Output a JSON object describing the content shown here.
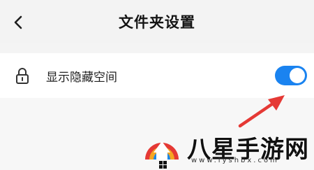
{
  "header": {
    "back_icon": "chevron-left-icon",
    "title": "文件夹设置"
  },
  "settings": {
    "hidden_space": {
      "icon": "lock-icon",
      "label": "显示隐藏空间",
      "enabled": true
    }
  },
  "watermark": {
    "text": "八星手游网",
    "url": "www.lyshbx.com",
    "logo_icon": "rainbow-house-logo-icon"
  },
  "annotation": {
    "arrow_icon": "red-arrow-icon"
  },
  "colors": {
    "toggle_on": "#1a83f0",
    "arrow": "#e53935",
    "background": "#f4f4f4",
    "row_background": "#ffffff"
  }
}
